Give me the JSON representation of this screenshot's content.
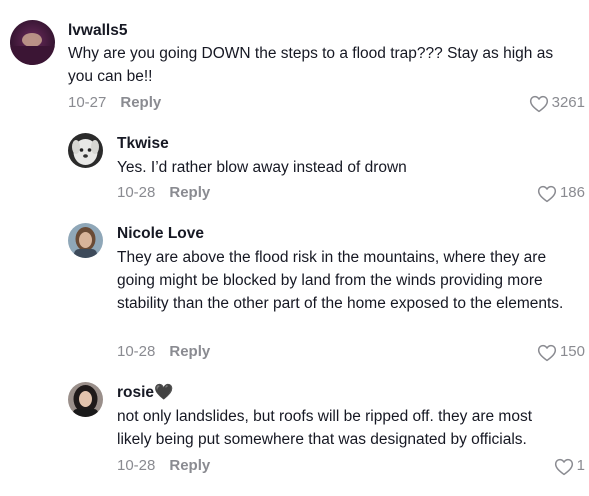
{
  "comments": [
    {
      "username": "lvwalls5",
      "text": "Why are you going DOWN the steps to a flood trap??? Stay as high as you can be!!",
      "date": "10-27",
      "reply_label": "Reply",
      "likes": "3261",
      "avatar_icon": "avatar-dark-purple"
    },
    {
      "username": "Tkwise",
      "text": "Yes. I’d rather blow away instead of drown",
      "date": "10-28",
      "reply_label": "Reply",
      "likes": "186",
      "avatar_icon": "avatar-white-dog"
    },
    {
      "username": "Nicole Love",
      "text": "They are above the flood risk in the mountains, where they are going might be blocked by land from the winds providing more stability than the other part of the home exposed to the elements.",
      "date": "10-28",
      "reply_label": "Reply",
      "likes": "150",
      "avatar_icon": "avatar-woman-photo"
    },
    {
      "username": "rosie🖤",
      "text": "not only landslides, but roofs will be ripped off. they are most likely being put somewhere that was designated by officials.",
      "date": "10-28",
      "reply_label": "Reply",
      "likes": "1",
      "avatar_icon": "avatar-woman-dark-hair"
    }
  ],
  "colors": {
    "text": "#161823",
    "muted": "#8a8b91"
  }
}
